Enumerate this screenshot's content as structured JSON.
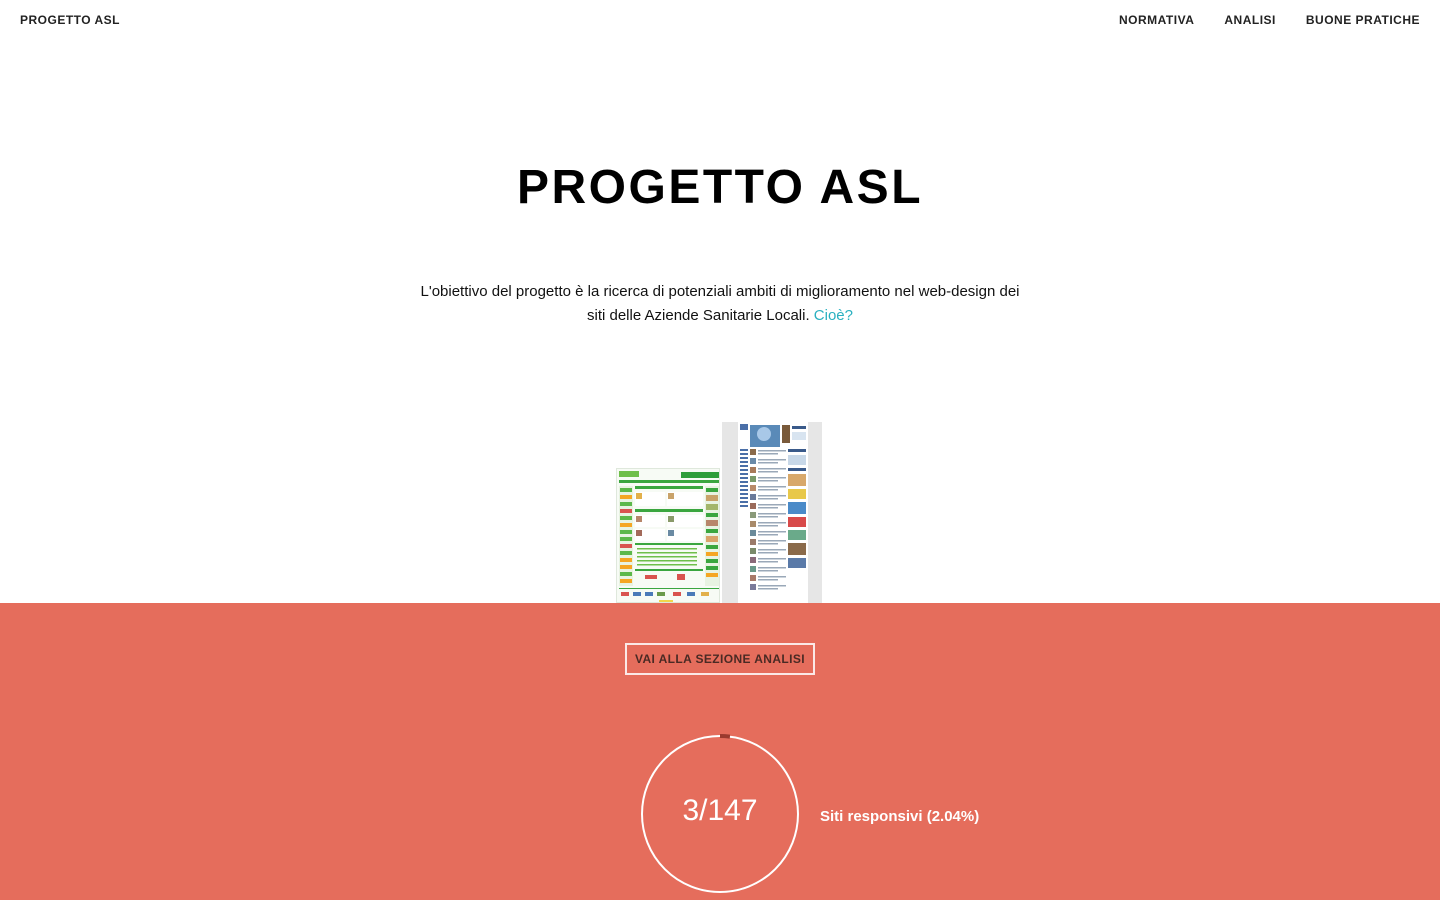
{
  "nav": {
    "brand": "PROGETTO ASL",
    "links": [
      "NORMATIVA",
      "ANALISI",
      "BUONE PRATICHE"
    ]
  },
  "hero": {
    "title": "PROGETTO ASL",
    "text": "L'obiettivo del progetto è la ricerca di potenziali ambiti di miglioramento nel web-design dei siti delle Aziende Sanitarie Locali.",
    "link": "Cioè?"
  },
  "analysis": {
    "cta": "VAI ALLA SEZIONE ANALISI",
    "stat_value": "3/147",
    "stat_label": "Siti responsivi (2.04%)",
    "responsive_count": 3,
    "total_sites": 147,
    "responsive_fraction": 0.0204
  },
  "colors": {
    "accent": "#e56d5c",
    "link": "#2ab0c0",
    "ring_progress": "#9a3a2e"
  },
  "icons": {
    "screenshot_left": "website-screenshot-green",
    "screenshot_right": "website-screenshot-blue"
  }
}
